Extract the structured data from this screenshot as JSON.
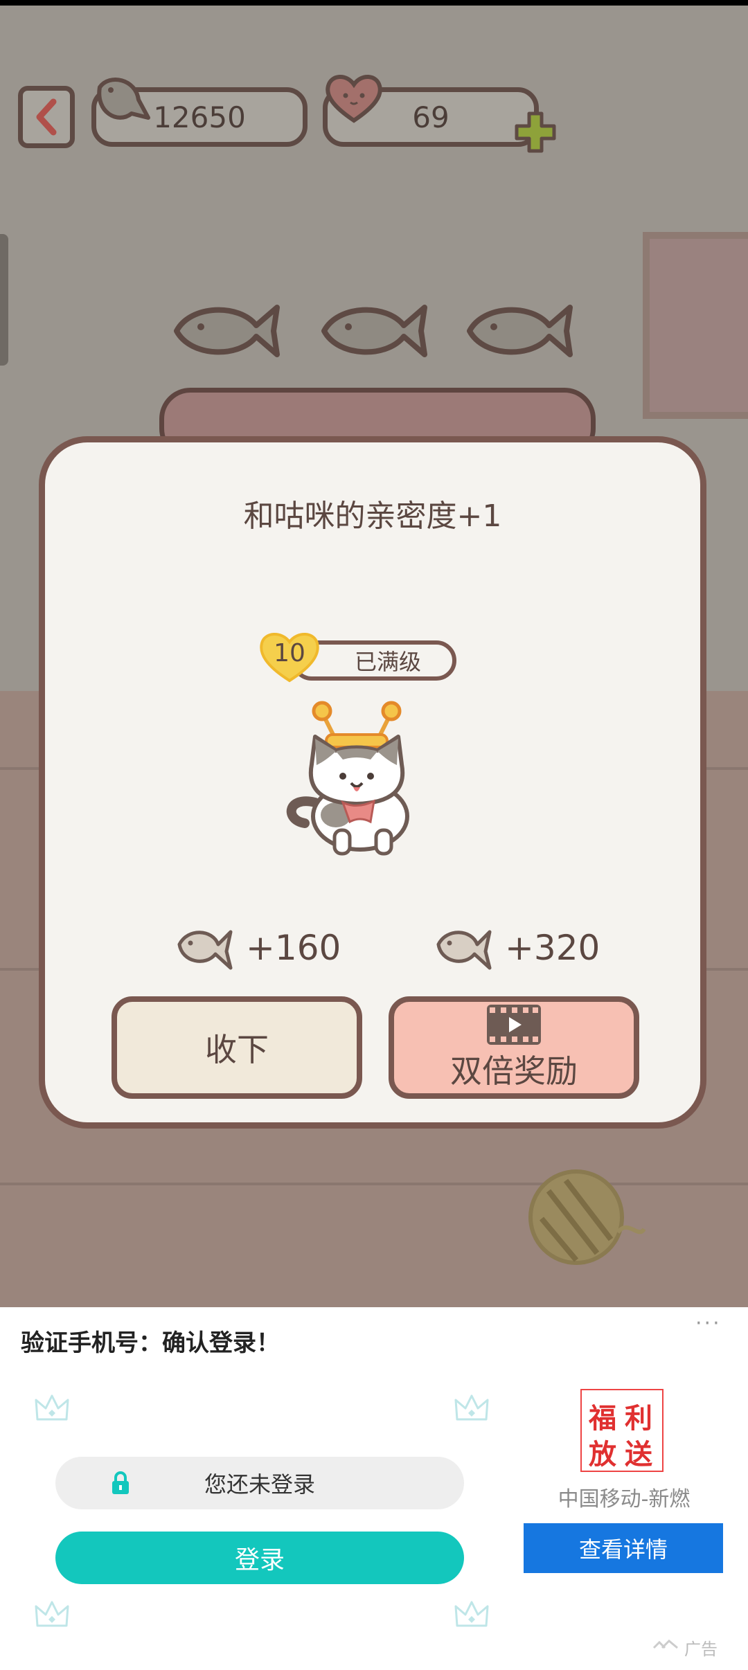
{
  "hud": {
    "fish_count": "12650",
    "heart_count": "69"
  },
  "dialog": {
    "title": "和咕咪的亲密度+1",
    "level": "10",
    "level_status": "已满级",
    "reward_normal": "+160",
    "reward_double": "+320",
    "collect_label": "收下",
    "double_label": "双倍奖励"
  },
  "ad": {
    "title": "验证手机号：确认登录！",
    "more": "···",
    "login_hint": "您还未登录",
    "login_button": "登录",
    "logo_text": [
      "福",
      "利",
      "放",
      "送"
    ],
    "sponsor": "中国移动-新燃",
    "cta": "查看详情",
    "label": "广告"
  },
  "colors": {
    "accent_teal": "#13c7bd",
    "cta_blue": "#1677e0",
    "dialog_border": "#7a5850",
    "double_button": "#f7c0b3"
  }
}
